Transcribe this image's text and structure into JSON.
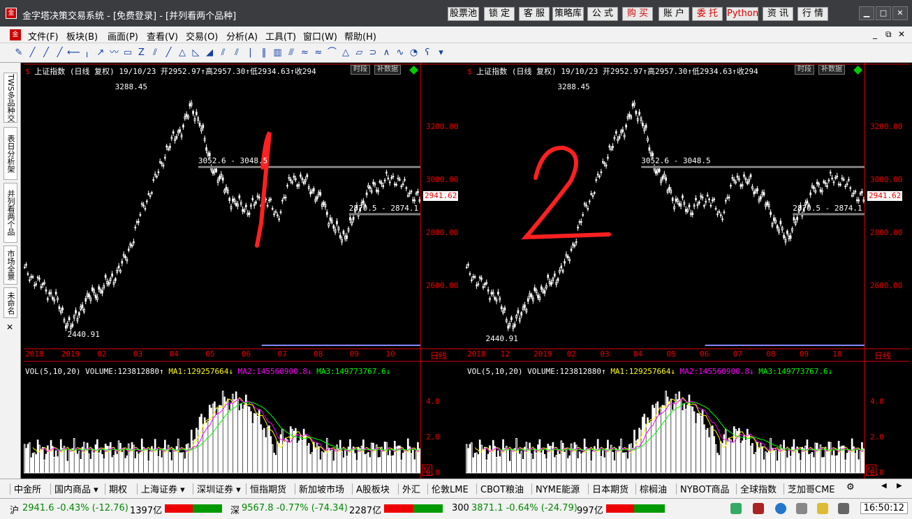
{
  "window": {
    "title": "金字塔决策交易系统 - [免费登录] - [并列看两个品种]",
    "buttons": [
      {
        "label": "股票池",
        "red": false
      },
      {
        "label": "锁 定",
        "red": false
      },
      {
        "label": "客 服",
        "red": false
      },
      {
        "label": "策略库",
        "red": false
      },
      {
        "label": "公 式",
        "red": false
      },
      {
        "label": "购 买",
        "red": true
      },
      {
        "label": "账 户",
        "red": false
      },
      {
        "label": "委 托",
        "red": true
      },
      {
        "label": "Python",
        "red": true
      },
      {
        "label": "资 讯",
        "red": false
      },
      {
        "label": "行 情",
        "red": false
      }
    ]
  },
  "menu": [
    "文件(F)",
    "板块(B)",
    "画面(P)",
    "查看(V)",
    "交易(O)",
    "分析(A)",
    "工具(T)",
    "窗口(W)",
    "帮助(H)"
  ],
  "sidebar": [
    "TWS多品种交",
    "表日分析架",
    "并列看两个品",
    "市场全景",
    "未命名"
  ],
  "panel": {
    "name": "上证指数",
    "period": "(日线 复权)",
    "date": "19/10/23",
    "open": "开2952.97",
    "high": "高2957.30",
    "low": "低2934.63",
    "close": "收294",
    "btn_time": "时段",
    "btn_fill": "补数据",
    "high_label": "3288.45",
    "low_label": "2440.91",
    "gap_upper": "3052.6 - 3048.5",
    "gap_lower": "2870.5 - 2874.1",
    "price_flag": "2941.62",
    "y_ticks": [
      "3200.00",
      "3000.00",
      "2800.00",
      "2600.00"
    ],
    "period_label": "日线",
    "vol_header": {
      "base": "VOL(5,10,20)",
      "volume": "VOLUME:123812880",
      "ma1": "MA1:129257664",
      "ma2": "MA2:145560900.8",
      "ma3": "MA3:149773767.6"
    },
    "vol_ticks": [
      "4.0",
      "2.0",
      "0.0"
    ],
    "vol_unit": "亿"
  },
  "panel1": {
    "x_ticks": [
      "2018",
      "2019",
      "02",
      "03",
      "04",
      "05",
      "06",
      "07",
      "08",
      "09",
      "10"
    ],
    "annotation": "1"
  },
  "panel2": {
    "x_ticks": [
      "2018",
      "12",
      "2019",
      "02",
      "03",
      "04",
      "05",
      "06",
      "07",
      "08",
      "09",
      "10"
    ],
    "annotation": "2"
  },
  "tabs": [
    "中金所",
    "国内商品",
    "期权",
    "上海证券",
    "深圳证券",
    "恒指期货",
    "新加坡市场",
    "A股板块",
    "外汇",
    "伦敦LME",
    "CBOT粮油",
    "NYME能源",
    "日本期货",
    "棕榈油",
    "NYBOT商品",
    "全球指数",
    "芝加哥CME"
  ],
  "status": {
    "sh": {
      "label": "沪",
      "value": "2941.6 -0.43% (-12.76)",
      "amount": "1397亿"
    },
    "sz": {
      "label": "深",
      "value": "9567.8 -0.77% (-74.34)",
      "amount": "2287亿"
    },
    "hs300": {
      "label": "300",
      "value": "3871.1 -0.64% (-24.79)",
      "amount": "997亿"
    },
    "clock": "16:50:12"
  },
  "colors": {
    "up": "#ffffff",
    "down": "#e00000",
    "axis": "#e00000",
    "ma1": "#ffff00",
    "ma2": "#ff00ff",
    "ma3": "#00ff00",
    "gap_line": "#808080",
    "pen": "#ff2020"
  }
}
